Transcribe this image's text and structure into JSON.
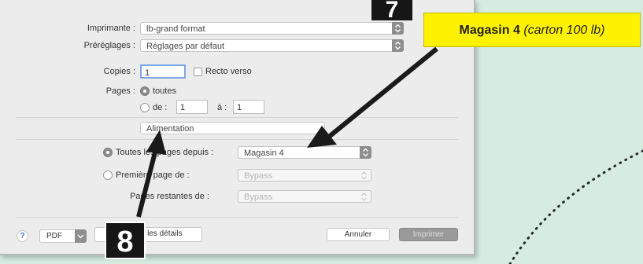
{
  "dialog": {
    "printer": {
      "label": "Imprimante :",
      "value": "lb-grand format"
    },
    "presets": {
      "label": "Préréglages :",
      "value": "Réglages par défaut"
    },
    "copies": {
      "label": "Copies :",
      "value": "1"
    },
    "duplex": {
      "label": "Recto verso",
      "checked": false
    },
    "pages": {
      "label": "Pages :",
      "all_label": "toutes",
      "range_from_label": "de :",
      "range_from_value": "1",
      "range_to_label": "à :",
      "range_to_value": "1",
      "selected": "all"
    },
    "section": {
      "value": "Alimentation"
    },
    "feed": {
      "all_pages": {
        "label": "Toutes les pages depuis :",
        "value": "Magasin 4",
        "selected": true
      },
      "first_page": {
        "label": "Première page de :",
        "value": "Bypass",
        "selected": false
      },
      "remaining": {
        "label": "Pages restantes de :",
        "value": "Bypass"
      }
    },
    "footer": {
      "help": "?",
      "pdf": "PDF",
      "details": "Masquer les détails",
      "cancel": "Annuler",
      "print": "Imprimer"
    }
  },
  "annotations": {
    "step7": "7",
    "step8": "8",
    "callout_bold": "Magasin 4",
    "callout_italic": "(carton 100 lb)",
    "callout_color": "#fff200",
    "marker_color": "#161616"
  }
}
